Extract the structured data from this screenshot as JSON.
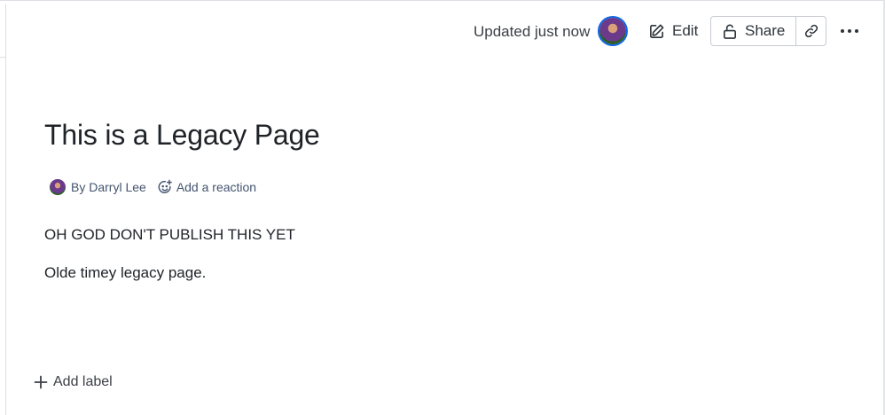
{
  "header": {
    "updated_text": "Updated just now",
    "edit_label": "Edit",
    "share_label": "Share"
  },
  "page": {
    "title": "This is a Legacy Page",
    "author": "By Darryl Lee",
    "reaction_label": "Add a reaction",
    "paragraphs": [
      "OH GOD DON'T PUBLISH THIS YET",
      "Olde timey legacy page."
    ]
  },
  "footer": {
    "add_label": "Add label"
  },
  "icons": {
    "edit": "pencil-square-icon",
    "share": "lock-open-icon",
    "link": "link-icon",
    "more": "ellipsis-icon",
    "reaction": "smiley-plus-icon",
    "add": "plus-icon"
  },
  "colors": {
    "accent": "#0c66e4",
    "text": "#1f2328",
    "border": "#c7cbd1"
  }
}
